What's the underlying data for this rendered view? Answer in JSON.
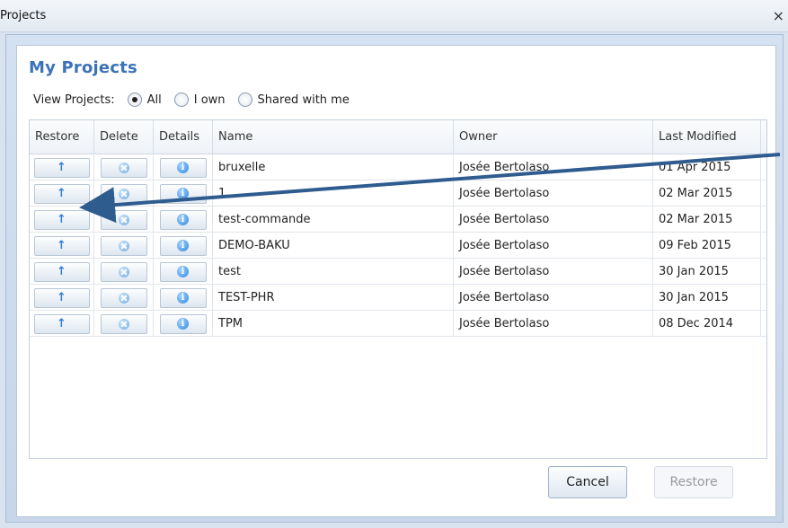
{
  "window": {
    "title": "Projects",
    "close_symbol": "×"
  },
  "dialog": {
    "heading": "My Projects",
    "view_projects": {
      "label": "View Projects:",
      "options": [
        {
          "label": "All",
          "selected": true
        },
        {
          "label": "I own",
          "selected": false
        },
        {
          "label": "Shared with me",
          "selected": false
        }
      ]
    },
    "columns": [
      "Restore",
      "Delete",
      "Details",
      "Name",
      "Owner",
      "Last Modified"
    ],
    "rows": [
      {
        "name": "bruxelle",
        "owner": "Josée Bertolaso",
        "modified": "01 Apr 2015"
      },
      {
        "name": "1",
        "owner": "Josée Bertolaso",
        "modified": "02 Mar 2015"
      },
      {
        "name": "test-commande",
        "owner": "Josée Bertolaso",
        "modified": "02 Mar 2015"
      },
      {
        "name": "DEMO-BAKU",
        "owner": "Josée Bertolaso",
        "modified": "09 Feb 2015"
      },
      {
        "name": "test",
        "owner": "Josée Bertolaso",
        "modified": "30 Jan 2015"
      },
      {
        "name": "TEST-PHR",
        "owner": "Josée Bertolaso",
        "modified": "30 Jan 2015"
      },
      {
        "name": "TPM",
        "owner": "Josée Bertolaso",
        "modified": "08 Dec 2014"
      }
    ],
    "row_icons": {
      "restore": "up-arrow-icon",
      "delete": "delete-icon",
      "details": "info-icon"
    },
    "buttons": {
      "cancel": "Cancel",
      "restore": "Restore"
    }
  },
  "colors": {
    "heading": "#3b73b9",
    "annotation_arrow": "#2f5c8e"
  }
}
